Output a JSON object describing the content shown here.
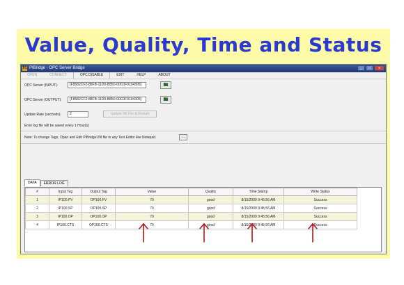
{
  "slide": {
    "title": "Value, Quality, Time and Status"
  },
  "window": {
    "title": "PIBridge - OPC Server Bridge",
    "icon_text": "TC"
  },
  "menu": {
    "items": [
      {
        "label": "OPEN",
        "disabled": true
      },
      {
        "label": "CONNECT",
        "disabled": true
      },
      {
        "label": "OPC DISABLE",
        "disabled": false
      },
      {
        "label": "EXIT",
        "disabled": false
      },
      {
        "label": "HELP",
        "disabled": false
      },
      {
        "label": "ABOUT",
        "disabled": false
      }
    ]
  },
  "form": {
    "input_label": "OPC Server (INPUT):",
    "input_value": "{F8582CF2-88FB-11D0-B850-00C0F0104305}",
    "output_label": "OPC Server (OUTPUT):",
    "output_value": "{F8582CF2-88FB-11D0-B850-00C0F0104305}",
    "rate_label": "Update Rate (seconds):",
    "rate_value": "2",
    "update_button": "Update INI File & Restart",
    "log_text": "Error log file will be saved every 1 Hour(s)",
    "note_text": "Note: To change Tags, Open and Edit PIBridge.INI file in any Text Editor like Notepad.",
    "note_button": "..."
  },
  "tabs": [
    "DATA",
    "ERROR LOG"
  ],
  "table": {
    "headers": [
      "#",
      "Input Tag",
      "Output Tag",
      "Value",
      "Quality",
      "Time Stamp",
      "Write Status"
    ],
    "rows": [
      [
        "1",
        "IP100.PV",
        "OP100.PV",
        "70",
        "good",
        "8/15/2009 9:45:56 AM",
        "Success"
      ],
      [
        "2",
        "IP100.SP",
        "OP100.SP",
        "70",
        "good",
        "8/15/2009 9:45:56 AM",
        "Success"
      ],
      [
        "3",
        "IP100.OP",
        "OP100.OP",
        "70",
        "good",
        "8/15/2009 9:45:56 AM",
        "Success"
      ],
      [
        "4",
        "IP100.CTS",
        "OP100.CTS",
        "70",
        "good",
        "8/15/2009 9:45:56 AM",
        "Success"
      ]
    ]
  },
  "colors": {
    "slide_bg": "#fdfba8",
    "title": "#2a3ad0",
    "arrow": "#b01818",
    "row_alt": "#f4f4dc"
  }
}
